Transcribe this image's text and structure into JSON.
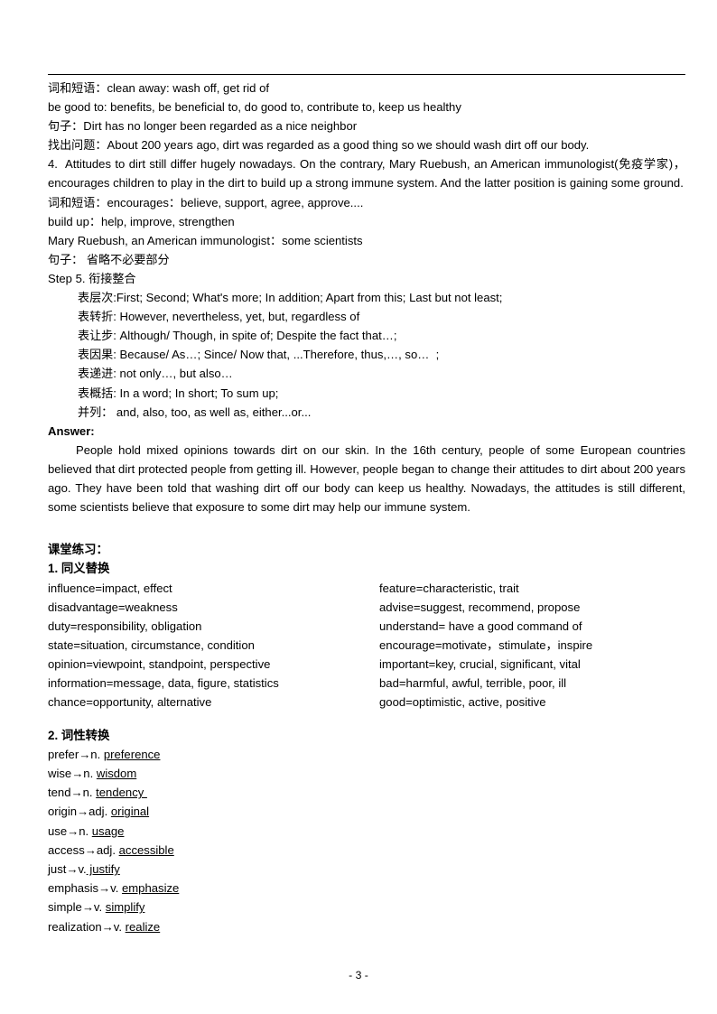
{
  "document": {
    "page_footer": "- 3 -"
  },
  "notes": {
    "lines": [
      "词和短语：clean away: wash off, get rid of",
      "be good to: benefits, be beneficial to, do good to, contribute to, keep us healthy",
      "句子：Dirt has no longer been regarded as a nice neighbor",
      "找出问题：About 200 years ago, dirt was regarded as a good thing so we should wash dirt off our body."
    ],
    "item4": "4.  Attitudes to dirt still differ hugely nowadays. On the contrary, Mary Ruebush, an American immunologist(免疫学家)，encourages children to play in the dirt to build up a strong immune system. And the latter position is gaining some ground.",
    "lines2": [
      "词和短语：encourages：believe, support, agree, approve....",
      "build up：help, improve, strengthen",
      "Mary Ruebush, an American immunologist：some scientists",
      "句子： 省略不必要部分"
    ]
  },
  "step5": {
    "title": "Step 5. 衔接整合",
    "items": [
      "表层次:First; Second; What's more; In addition; Apart from this; Last but not least;",
      "表转折: However, nevertheless, yet, but, regardless of",
      "表让步: Although/ Though, in spite of; Despite the fact that…;",
      "表因果: Because/ As…; Since/ Now that, ...Therefore, thus,…, so…  ;",
      "表递进: not only…, but also…",
      "表概括: In a word; In short; To sum up;",
      "并列： and, also, too, as well as, either...or..."
    ]
  },
  "answer": {
    "label": "Answer:",
    "text": "People hold mixed opinions towards dirt on our skin. In the 16th century, people of some European countries believed that dirt protected people from getting ill. However, people began to change their attitudes to dirt about 200 years ago. They have been told that washing dirt off our body can keep us healthy. Nowadays, the attitudes is still different, some scientists believe that exposure to some dirt may help our immune system."
  },
  "exercises": {
    "heading": "课堂练习：",
    "section1": {
      "title": "1. 同义替换",
      "left": [
        "influence=impact, effect",
        "disadvantage=weakness",
        "duty=responsibility, obligation",
        "state=situation, circumstance, condition",
        "opinion=viewpoint, standpoint, perspective",
        "information=message, data, figure, statistics",
        "chance=opportunity, alternative"
      ],
      "right": [
        "feature=characteristic, trait",
        "advise=suggest, recommend, propose",
        "understand= have a good command of",
        "encourage=motivate，stimulate，inspire",
        "important=key, crucial, significant, vital",
        "bad=harmful, awful, terrible, poor, ill",
        "good=optimistic, active, positive"
      ]
    },
    "section2": {
      "title": "2. 词性转换",
      "items": [
        {
          "base": "prefer→n. ",
          "derived": "preference"
        },
        {
          "base": "wise→n. ",
          "derived": "wisdom"
        },
        {
          "base": "tend→n. ",
          "derived": "tendency "
        },
        {
          "base": "origin→adj. ",
          "derived": "original"
        },
        {
          "base": "use→n. ",
          "derived": "usage"
        },
        {
          "base": "access→adj. ",
          "derived": "accessible"
        },
        {
          "base": "just→v.",
          "derived": " justify"
        },
        {
          "base": "emphasis→v. ",
          "derived": "emphasize"
        },
        {
          "base": "simple→v. ",
          "derived": "simplify"
        },
        {
          "base": "realization→v. ",
          "derived": "realize"
        }
      ]
    }
  }
}
